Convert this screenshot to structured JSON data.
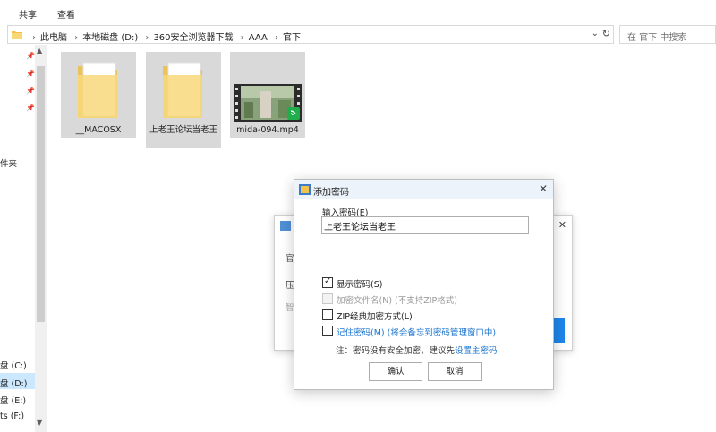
{
  "ribbon": {
    "share": "共享",
    "view": "查看"
  },
  "address": {
    "crumbs": [
      "此电脑",
      "本地磁盘 (D:)",
      "360安全浏览器下载",
      "AAA",
      "官下"
    ]
  },
  "search": {
    "placeholder": "在 官下 中搜索"
  },
  "nav": {
    "partial_label": "件夹",
    "drives": [
      "盘 (C:)",
      "盘 (D:)",
      "盘 (E:)",
      "ts (F:)"
    ]
  },
  "files": [
    {
      "name": "__MACOSX",
      "type": "folder"
    },
    {
      "name": "上老王论坛当老王",
      "type": "folder"
    },
    {
      "name": "mida-094.mp4",
      "type": "video"
    }
  ],
  "bg_dialog": {
    "label_frag_1": "官",
    "label_frag_2": "压",
    "label_frag_3": "智"
  },
  "dialog": {
    "title": "添加密码",
    "password_label": "输入密码(E)",
    "password_value": "上老王论坛当老王",
    "options": [
      {
        "label": "显示密码(S)",
        "checked": true,
        "enabled": true
      },
      {
        "label": "加密文件名(N) (不支持ZIP格式)",
        "checked": false,
        "enabled": false
      },
      {
        "label": "ZIP经典加密方式(L)",
        "checked": false,
        "enabled": true
      },
      {
        "label": "记住密码(M) (将会备忘到密码管理窗口中)",
        "checked": false,
        "enabled": true
      }
    ],
    "note_prefix": "注：密码没有安全加密，建议先",
    "note_link": "设置主密码",
    "ok": "确认",
    "cancel": "取消"
  },
  "colors": {
    "accent": "#1b75d0",
    "selection": "#d9d9d9",
    "folder": "#f6d365"
  }
}
